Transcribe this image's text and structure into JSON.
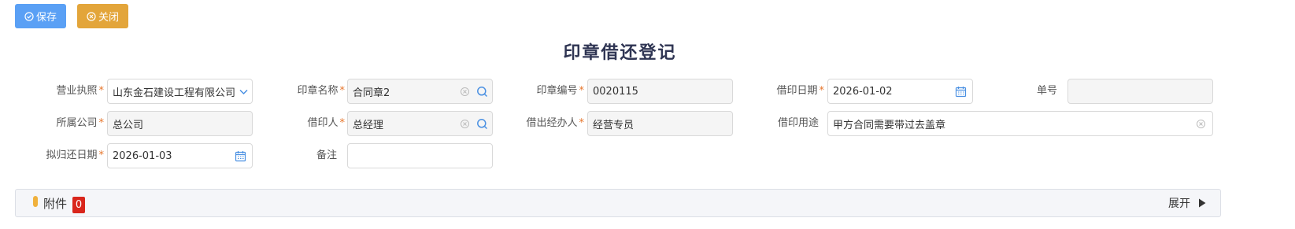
{
  "toolbar": {
    "save_label": "保存",
    "close_label": "关闭"
  },
  "form_title": "印章借还登记",
  "required_mark": "*",
  "fields": {
    "business_license": {
      "label": "营业执照",
      "value": "山东金石建设工程有限公司"
    },
    "company": {
      "label": "所属公司",
      "value": "总公司"
    },
    "return_date": {
      "label": "拟归还日期",
      "value": "2026-01-03"
    },
    "seal_name": {
      "label": "印章名称",
      "value": "合同章2"
    },
    "borrower": {
      "label": "借印人",
      "value": "总经理"
    },
    "remark": {
      "label": "备注",
      "value": ""
    },
    "seal_no": {
      "label": "印章编号",
      "value": "0020115"
    },
    "handler": {
      "label": "借出经办人",
      "value": "经营专员"
    },
    "borrow_date": {
      "label": "借印日期",
      "value": "2026-01-02"
    },
    "purpose": {
      "label": "借印用途",
      "value": "甲方合同需要带过去盖章"
    },
    "doc_no": {
      "label": "单号",
      "value": ""
    }
  },
  "attachments": {
    "title": "附件",
    "count": "0",
    "expand_label": "展开"
  },
  "colors": {
    "save": "#5aa0f5",
    "close": "#e3a53a",
    "required": "#e6752a",
    "badge": "#d9261c",
    "icon": "#4a90e2"
  }
}
